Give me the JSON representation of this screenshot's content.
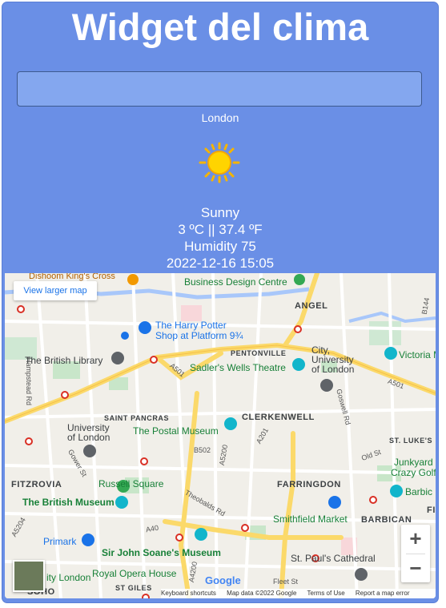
{
  "header": {
    "title": "Widget del clima"
  },
  "search": {
    "value": "",
    "placeholder": ""
  },
  "weather": {
    "city": "London",
    "icon": "sun-icon",
    "condition": "Sunny",
    "temperature": "3 ºC || 37.4 ºF",
    "humidity": "Humidity 75",
    "datetime": "2022-12-16 15:05"
  },
  "map": {
    "view_larger": "View larger map",
    "zoom_in": "+",
    "zoom_out": "−",
    "google": "Google",
    "footer": {
      "shortcuts": "Keyboard shortcuts",
      "data": "Map data ©2022 Google",
      "terms": "Terms of Use",
      "report": "Report a map error"
    },
    "areas": {
      "angel": "ANGEL",
      "pentonville": "PENTONVILLE",
      "clerkenwell": "CLERKENWELL",
      "saint_pancras": "SAINT PANCRAS",
      "fitzrovia": "FITZROVIA",
      "farringdon": "FARRINGDON",
      "barbican": "BARBICAN",
      "st_lukes": "ST. LUKE'S",
      "st_giles": "ST GILES",
      "soho": "SOHO",
      "fi": "FI"
    },
    "places": {
      "dishoom": "Dishoom King's Cross",
      "business_design": "Business Design Centre",
      "harry_potter_1": "The Harry Potter",
      "harry_potter_2": "Shop at Platform 9¾",
      "british_library": "The British Library",
      "sadlers": "Sadler's Wells Theatre",
      "city_uni_1": "City,",
      "city_uni_2": "University",
      "city_uni_3": "of London",
      "victoria": "Victoria M",
      "uni_london_1": "University",
      "uni_london_2": "of London",
      "postal_museum": "The Postal Museum",
      "russell_square": "Russell Square",
      "british_museum": "The British Museum",
      "junkyard_1": "Junkyard",
      "junkyard_2": "Crazy Golf",
      "barbic": "Barbic",
      "smithfield": "Smithfield Market",
      "primark": "Primark",
      "soane": "Sir John Soane's Museum",
      "st_pauls": "St. Paul's Cathedral",
      "royal_opera": "Royal Opera House",
      "city_london": "ity London"
    },
    "roads": {
      "a501": "A501",
      "a501b": "A501",
      "a201": "A201",
      "a5200": "A5200",
      "b502": "B502",
      "a40": "A40",
      "a4200": "A4200",
      "a5204": "A5204",
      "gower": "Gower St",
      "hampstead": "Hampstead Rd",
      "goswell": "Goswell Rd",
      "theobalds": "Theobalds Rd",
      "old_st": "Old St",
      "b144": "B144",
      "fleet": "Fleet St"
    }
  }
}
